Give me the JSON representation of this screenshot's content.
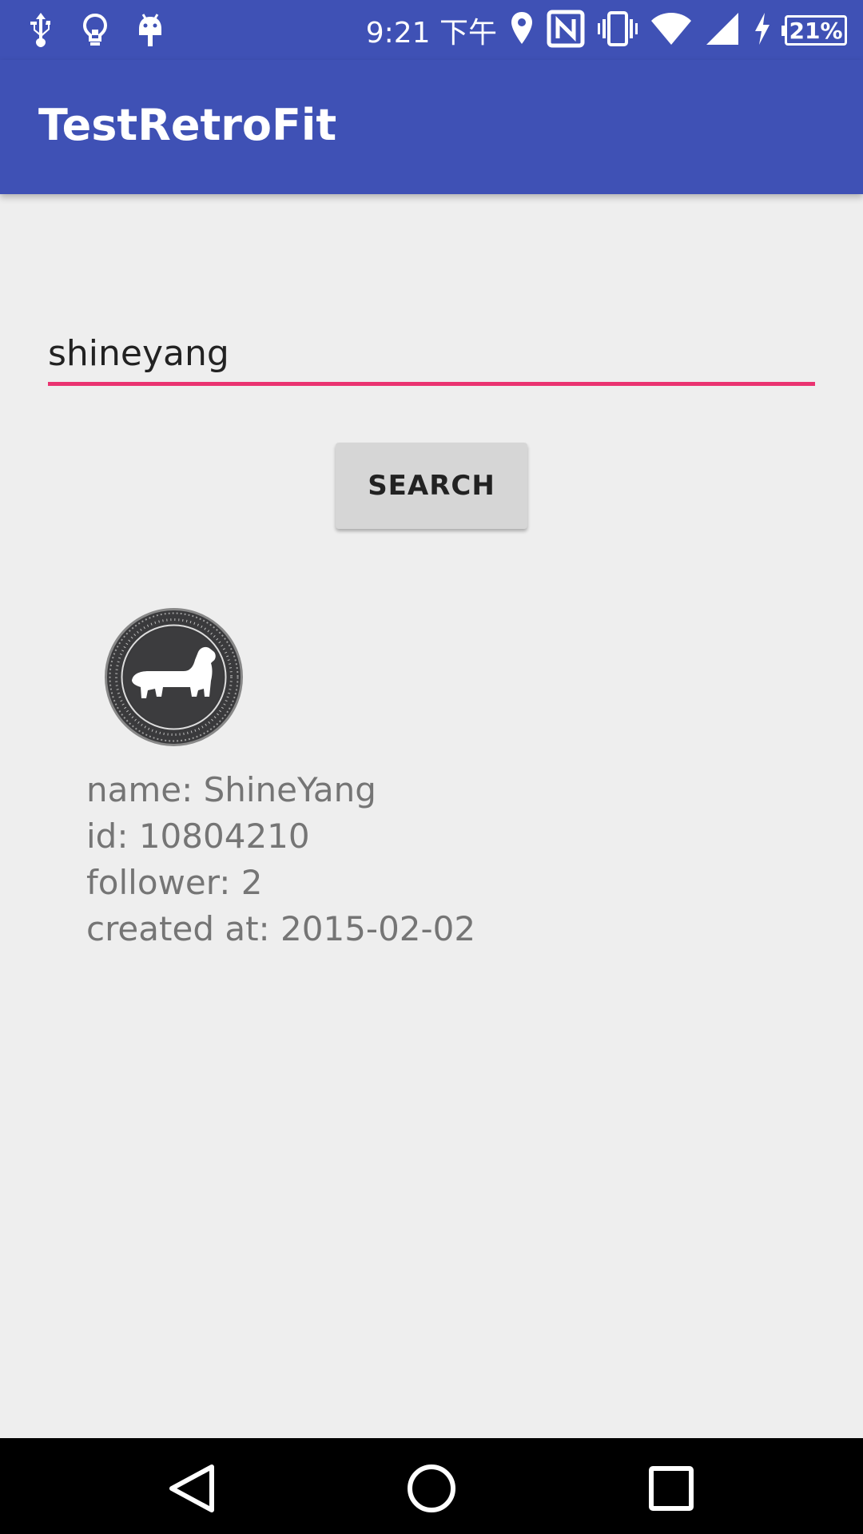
{
  "status_bar": {
    "time": "9:21 下午",
    "battery": "21%",
    "left_icons": [
      "usb-icon",
      "lightbulb-icon",
      "android-icon"
    ],
    "right_icons": [
      "location-icon",
      "nfc-icon",
      "vibrate-icon",
      "wifi-icon",
      "cell-signal-icon",
      "charging-icon",
      "battery-icon"
    ]
  },
  "app_bar": {
    "title": "TestRetroFit"
  },
  "search": {
    "value": "shineyang",
    "button_label": "SEARCH"
  },
  "profile": {
    "name": "name: ShineYang",
    "id": "id: 10804210",
    "follower": "follower: 2",
    "created_at": "created at: 2015-02-02"
  },
  "nav_bar": {
    "buttons": [
      "back-icon",
      "home-icon",
      "recents-icon"
    ]
  },
  "colors": {
    "primary": "#3f51b5",
    "accent": "#e91e63",
    "background": "#eeeeee",
    "button": "#d6d6d6",
    "text_secondary": "#757575"
  }
}
